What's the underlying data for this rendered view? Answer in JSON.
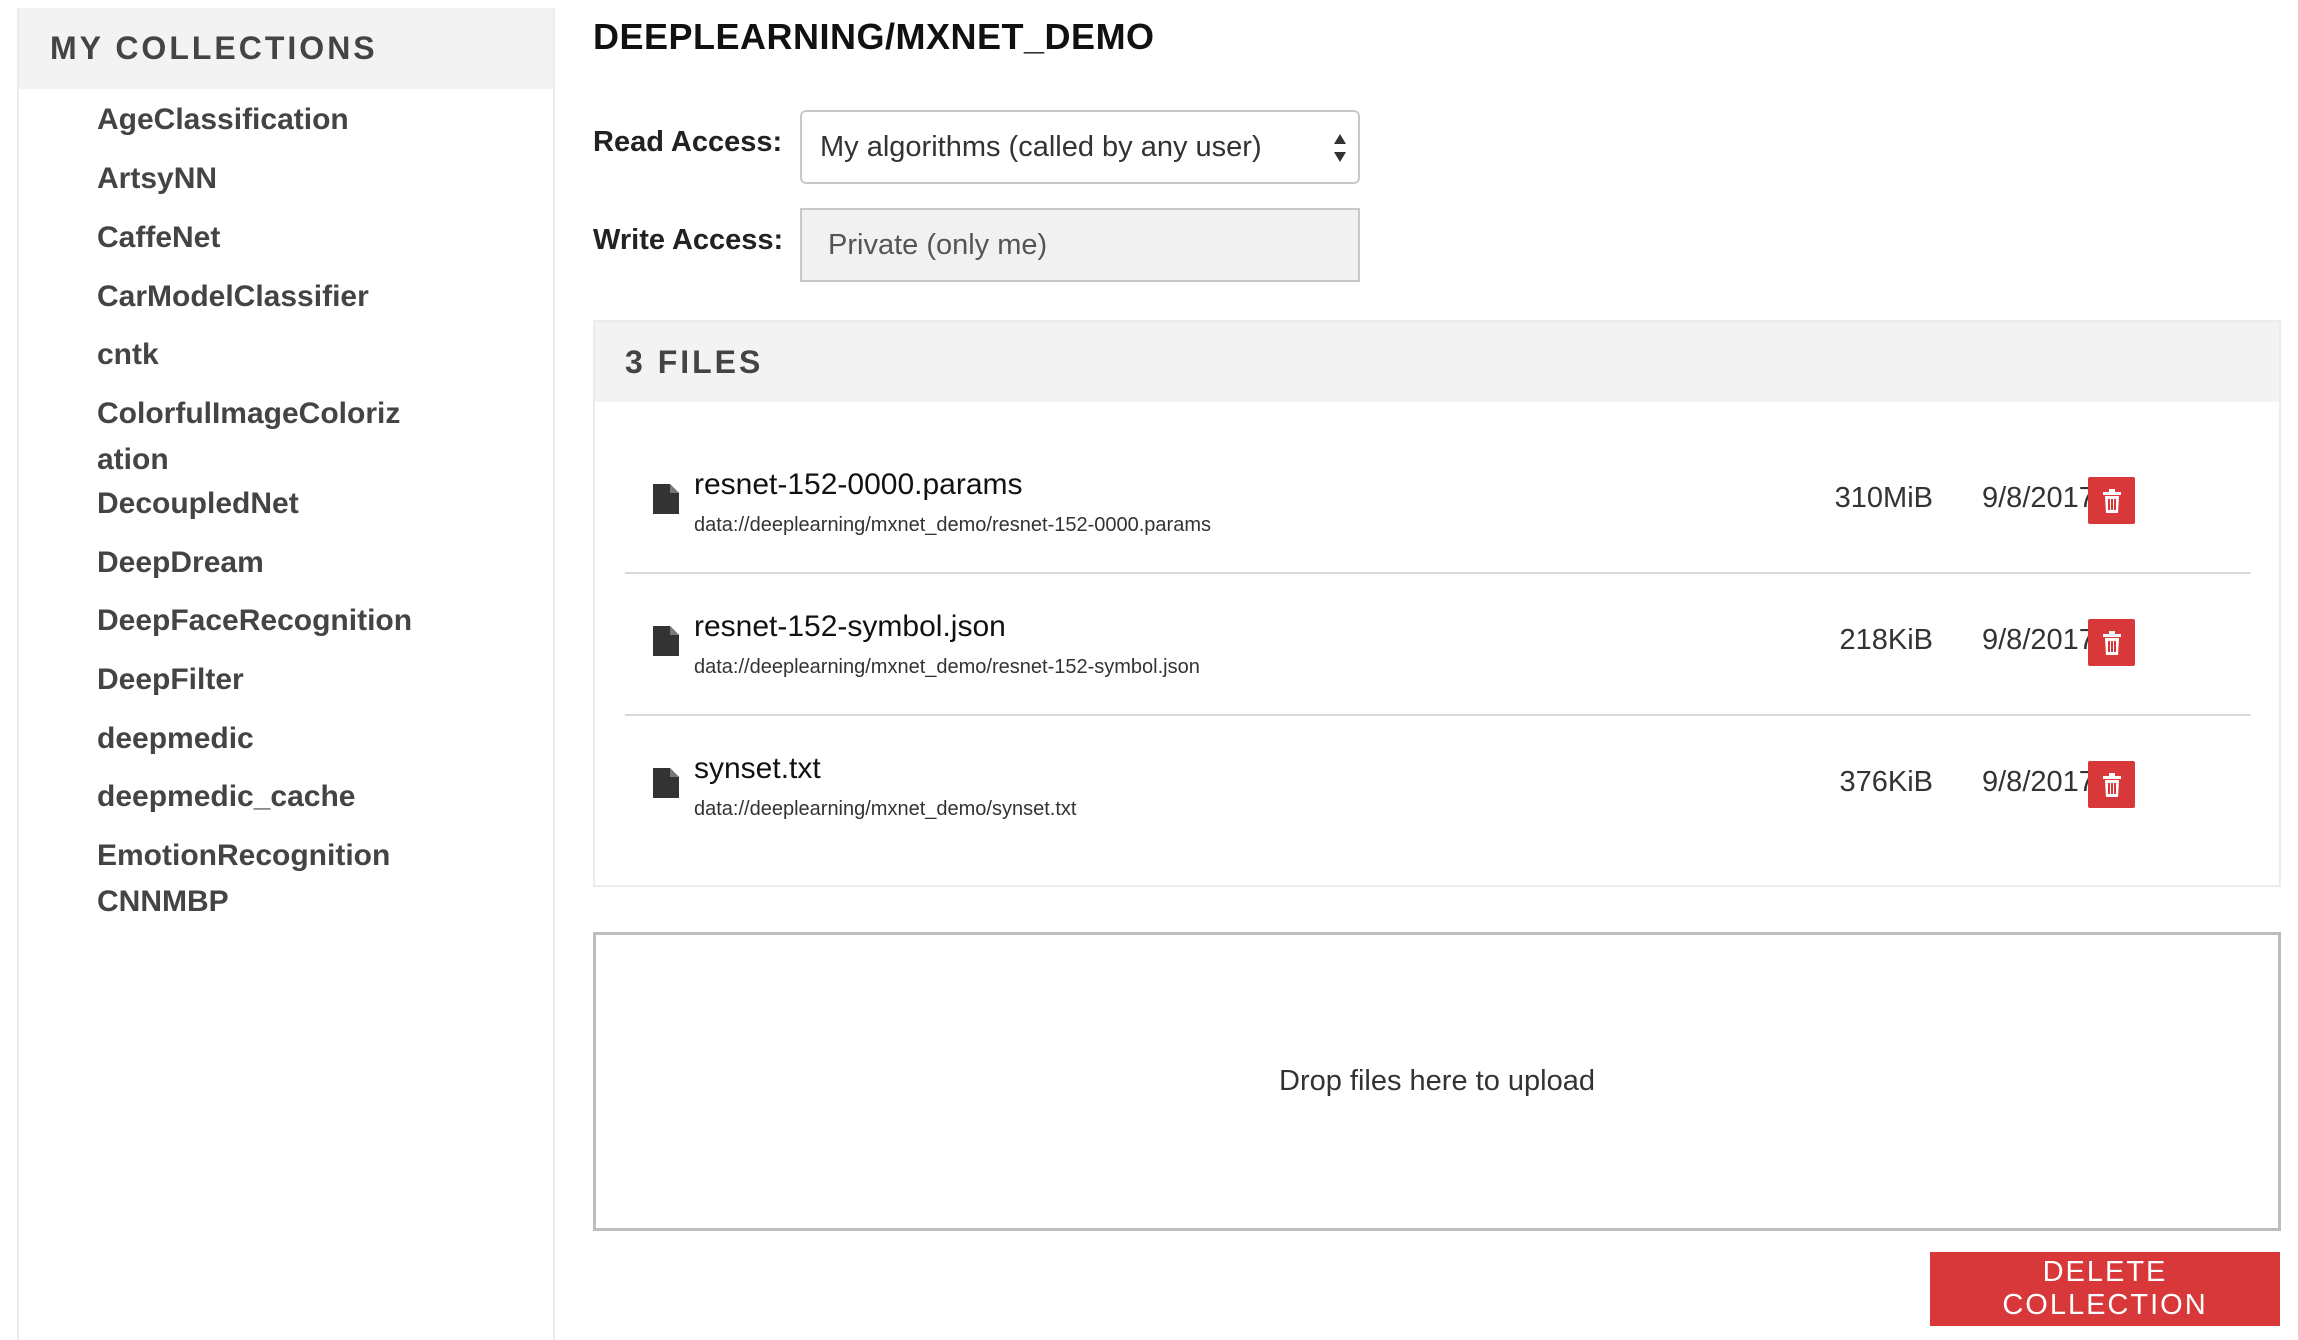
{
  "sidebar": {
    "header": "MY COLLECTIONS",
    "items": [
      {
        "label": "AgeClassification"
      },
      {
        "label": "ArtsyNN"
      },
      {
        "label": "CaffeNet"
      },
      {
        "label": "CarModelClassifier"
      },
      {
        "label": "cntk"
      },
      {
        "label": "ColorfulImageColorization"
      },
      {
        "label": "DecoupledNet"
      },
      {
        "label": "DeepDream"
      },
      {
        "label": "DeepFaceRecognition"
      },
      {
        "label": "DeepFilter"
      },
      {
        "label": "deepmedic"
      },
      {
        "label": "deepmedic_cache"
      },
      {
        "label": "EmotionRecognitionCNNMBP"
      }
    ]
  },
  "main": {
    "title": "DEEPLEARNING/MXNET_DEMO",
    "read_access": {
      "label": "Read Access:",
      "value": "My algorithms (called by any user)"
    },
    "write_access": {
      "label": "Write Access:",
      "value": "Private (only me)"
    },
    "files": {
      "header": "3 FILES",
      "rows": [
        {
          "name": "resnet-152-0000.params",
          "path": "data://deeplearning/mxnet_demo/resnet-152-0000.params",
          "size": "310MiB",
          "date": "9/8/2017"
        },
        {
          "name": "resnet-152-symbol.json",
          "path": "data://deeplearning/mxnet_demo/resnet-152-symbol.json",
          "size": "218KiB",
          "date": "9/8/2017"
        },
        {
          "name": "synset.txt",
          "path": "data://deeplearning/mxnet_demo/synset.txt",
          "size": "376KiB",
          "date": "9/8/2017"
        }
      ]
    },
    "dropzone_text": "Drop files here to upload",
    "delete_collection_label": "DELETE COLLECTION"
  },
  "colors": {
    "accent_red": "#d9383a",
    "panel_gray": "#f3f3f3"
  },
  "icons": {
    "file": "file-icon",
    "delete": "trash-icon",
    "select": "select-arrows-icon"
  }
}
